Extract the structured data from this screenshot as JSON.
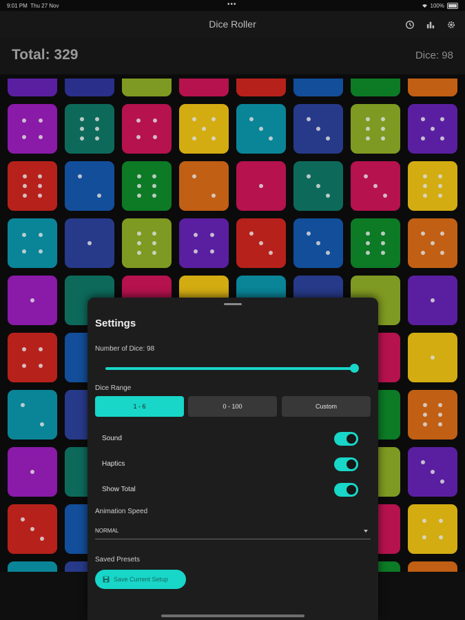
{
  "status_bar": {
    "time": "9:01 PM",
    "date": "Thu 27 Nov",
    "battery": "100%"
  },
  "app_bar": {
    "title": "Dice Roller",
    "icons": [
      "history-icon",
      "bar-chart-icon",
      "gear-icon"
    ]
  },
  "summary": {
    "total": "Total: 329",
    "dice": "Dice: 98"
  },
  "settings": {
    "title": "Settings",
    "number_of_dice_label": "Number of Dice: 98",
    "slider_value": 98,
    "dice_range_label": "Dice Range",
    "range_options": [
      "1 - 6",
      "0 - 100",
      "Custom"
    ],
    "range_selected": "1 - 6",
    "sound_label": "Sound",
    "sound_on": true,
    "haptics_label": "Haptics",
    "haptics_on": true,
    "show_total_label": "Show Total",
    "show_total_on": true,
    "animation_speed_label": "Animation Speed",
    "animation_speed_value": "NORMAL",
    "saved_presets_label": "Saved Presets",
    "save_button_label": "Save Current Setup"
  },
  "colors": {
    "accent": "#18d6c8"
  },
  "dice_grid": {
    "palette": [
      "#8a1aa8",
      "#0d6a5b",
      "#b5124e",
      "#d3ac12",
      "#0a8598",
      "#273a8a",
      "#7f9a22",
      "#c15f14",
      "#b7211b",
      "#134e9a",
      "#0d7a26",
      "#1a8aa6",
      "#5a1fa0",
      "#2a2f8a",
      "#5b8a22"
    ],
    "rows": [
      [
        [
          12,
          0
        ],
        [
          13,
          0
        ],
        [
          6,
          0
        ],
        [
          2,
          0
        ],
        [
          8,
          0
        ],
        [
          9,
          0
        ],
        [
          10,
          0
        ],
        [
          7,
          0
        ]
      ],
      [
        [
          0,
          4
        ],
        [
          1,
          6
        ],
        [
          2,
          4
        ],
        [
          3,
          5
        ],
        [
          4,
          3
        ],
        [
          5,
          3
        ],
        [
          6,
          6
        ],
        [
          12,
          5
        ]
      ],
      [
        [
          8,
          6
        ],
        [
          9,
          2
        ],
        [
          10,
          6
        ],
        [
          7,
          2
        ],
        [
          2,
          1
        ],
        [
          1,
          3
        ],
        [
          2,
          3
        ],
        [
          3,
          6
        ]
      ],
      [
        [
          4,
          4
        ],
        [
          5,
          1
        ],
        [
          6,
          6
        ],
        [
          12,
          4
        ],
        [
          8,
          3
        ],
        [
          9,
          3
        ],
        [
          10,
          6
        ],
        [
          7,
          5
        ]
      ],
      [
        [
          0,
          1
        ],
        [
          1,
          0
        ],
        [
          2,
          0
        ],
        [
          3,
          0
        ],
        [
          4,
          0
        ],
        [
          5,
          0
        ],
        [
          6,
          0
        ],
        [
          12,
          1
        ]
      ],
      [
        [
          8,
          4
        ],
        [
          9,
          0
        ],
        [
          0,
          0
        ],
        [
          0,
          0
        ],
        [
          0,
          0
        ],
        [
          0,
          0
        ],
        [
          2,
          0
        ],
        [
          3,
          1
        ]
      ],
      [
        [
          4,
          2
        ],
        [
          5,
          0
        ],
        [
          0,
          0
        ],
        [
          0,
          0
        ],
        [
          0,
          0
        ],
        [
          0,
          0
        ],
        [
          10,
          0
        ],
        [
          7,
          6
        ]
      ],
      [
        [
          0,
          1
        ],
        [
          1,
          0
        ],
        [
          0,
          0
        ],
        [
          0,
          0
        ],
        [
          0,
          0
        ],
        [
          0,
          0
        ],
        [
          6,
          0
        ],
        [
          12,
          3
        ]
      ],
      [
        [
          8,
          3
        ],
        [
          9,
          0
        ],
        [
          0,
          0
        ],
        [
          0,
          0
        ],
        [
          0,
          0
        ],
        [
          0,
          0
        ],
        [
          2,
          0
        ],
        [
          3,
          4
        ]
      ],
      [
        [
          4,
          0
        ],
        [
          5,
          0
        ],
        [
          0,
          0
        ],
        [
          0,
          0
        ],
        [
          0,
          0
        ],
        [
          0,
          0
        ],
        [
          10,
          0
        ],
        [
          7,
          0
        ]
      ]
    ]
  }
}
